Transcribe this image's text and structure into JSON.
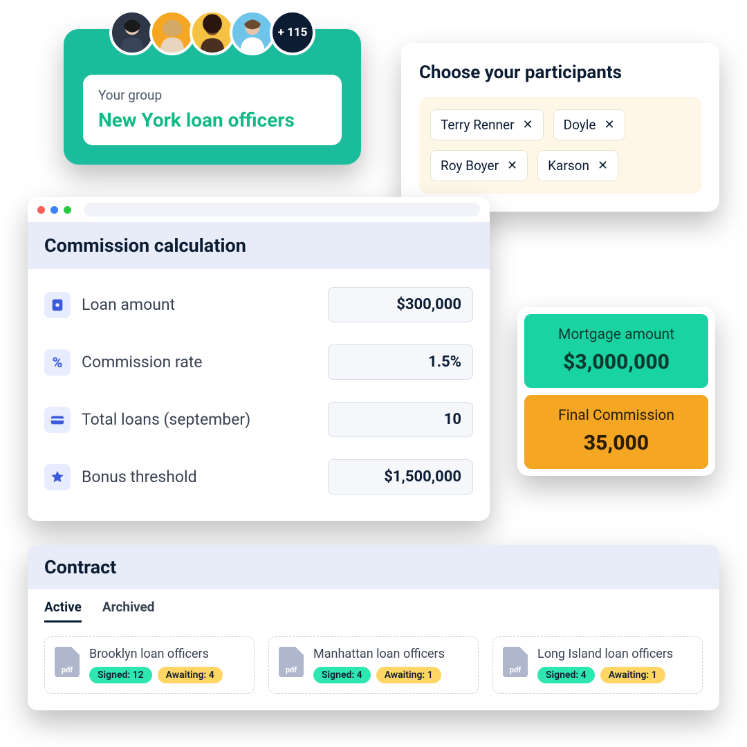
{
  "group": {
    "label": "Your group",
    "name": "New York loan officers",
    "overflow": "+ 115",
    "avatar_colors": [
      "#2d3748",
      "#f5a623",
      "#f6c244",
      "#6fc4ea"
    ]
  },
  "participants": {
    "title": "Choose your participants",
    "chips": [
      {
        "name": "Terry Renner"
      },
      {
        "name": "Doyle"
      },
      {
        "name": "Roy Boyer"
      },
      {
        "name": "Karson"
      }
    ]
  },
  "commission": {
    "title": "Commission calculation",
    "rows": [
      {
        "label": "Loan amount",
        "value": "$300,000",
        "icon": "money-icon"
      },
      {
        "label": "Commission rate",
        "value": "1.5%",
        "icon": "percent-icon"
      },
      {
        "label": "Total loans (september)",
        "value": "10",
        "icon": "card-icon"
      },
      {
        "label": "Bonus threshold",
        "value": "$1,500,000",
        "icon": "star-icon"
      }
    ]
  },
  "results": {
    "mortgage_label": "Mortgage amount",
    "mortgage_value": "$3,000,000",
    "final_label": "Final Commission",
    "final_value": "35,000"
  },
  "contract": {
    "title": "Contract",
    "tabs": {
      "active": "Active",
      "archived": "Archived"
    },
    "pdf_label": "pdf",
    "cards": [
      {
        "name": "Brooklyn loan officers",
        "signed": "Signed: 12",
        "awaiting": "Awaiting: 4"
      },
      {
        "name": "Manhattan loan officers",
        "signed": "Signed: 4",
        "awaiting": "Awaiting: 1"
      },
      {
        "name": "Long Island loan officers",
        "signed": "Signed: 4",
        "awaiting": "Awaiting: 1"
      }
    ]
  }
}
